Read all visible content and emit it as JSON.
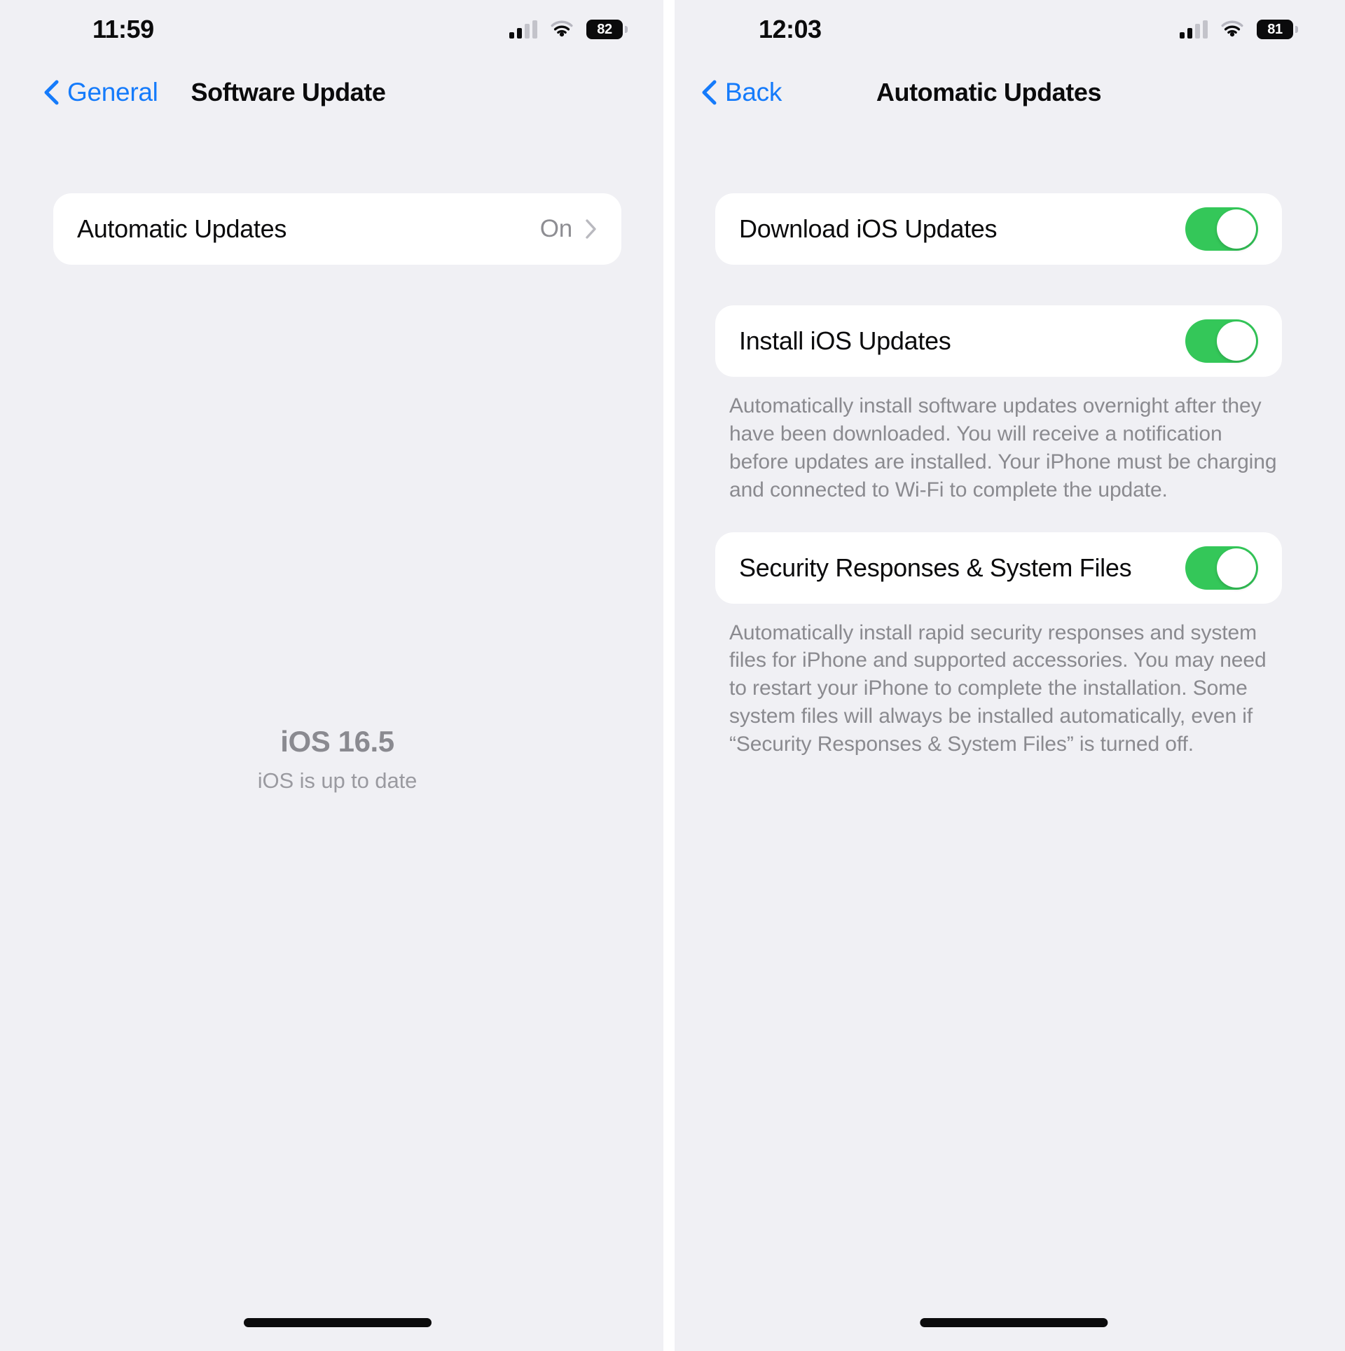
{
  "left_screen": {
    "status_bar": {
      "time": "11:59",
      "cellular_icon": "cellular-signal-icon",
      "wifi_icon": "wifi-icon",
      "battery_level": "82"
    },
    "nav": {
      "back_label": "General",
      "back_icon": "chevron-left-icon",
      "title": "Software Update"
    },
    "rows": [
      {
        "label": "Automatic Updates",
        "value": "On",
        "disclosure_icon": "chevron-right-icon"
      }
    ],
    "version": {
      "title": "iOS 16.5",
      "subtitle": "iOS is up to date"
    }
  },
  "right_screen": {
    "status_bar": {
      "time": "12:03",
      "cellular_icon": "cellular-signal-icon",
      "wifi_icon": "wifi-icon",
      "battery_level": "81"
    },
    "nav": {
      "back_label": "Back",
      "back_icon": "chevron-left-icon",
      "title": "Automatic Updates"
    },
    "groups": [
      {
        "rows": [
          {
            "label": "Download iOS Updates",
            "toggle_state": "on"
          }
        ],
        "footnote": ""
      },
      {
        "rows": [
          {
            "label": "Install iOS Updates",
            "toggle_state": "on"
          }
        ],
        "footnote": "Automatically install software updates overnight after they have been downloaded. You will receive a notification before updates are installed. Your iPhone must be charging and connected to Wi-Fi to complete the update."
      },
      {
        "rows": [
          {
            "label": "Security Responses & System Files",
            "toggle_state": "on"
          }
        ],
        "footnote": "Automatically install rapid security responses and system files for iPhone and supported accessories. You may need to restart your iPhone to complete the installation. Some system files will always be installed automatically, even if “Security Responses & System Files” is turned off."
      }
    ]
  },
  "colors": {
    "accent_blue": "#157bfb",
    "toggle_green": "#34c759",
    "background": "#f0f0f4",
    "card": "#ffffff",
    "secondary_text": "#8e8e93"
  }
}
